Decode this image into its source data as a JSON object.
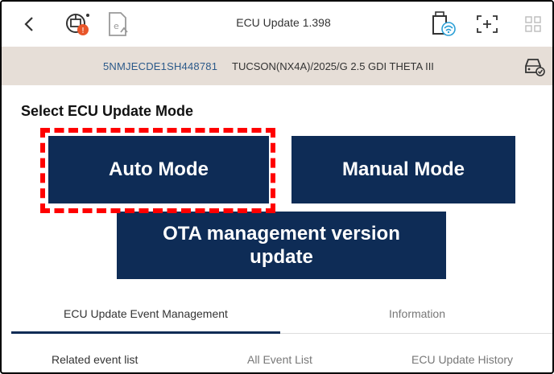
{
  "header": {
    "title": "ECU Update 1.398",
    "icons": [
      "back-chevron",
      "engine-warning",
      "ecu-document-upload",
      "vci-wireless",
      "screen-capture",
      "grid-menu"
    ]
  },
  "vehicle": {
    "vin": "5NMJECDE1SH448781",
    "model": "TUCSON(NX4A)/2025/G 2.5 GDI THETA III"
  },
  "main": {
    "heading": "Select ECU Update Mode",
    "buttons": {
      "auto": "Auto Mode",
      "manual": "Manual Mode",
      "ota": "OTA management version update"
    }
  },
  "tabs": [
    {
      "label": "ECU Update Event Management",
      "active": true
    },
    {
      "label": "Information",
      "active": false
    }
  ],
  "subtabs": [
    {
      "label": "Related event list",
      "active": true
    },
    {
      "label": "All Event List",
      "active": false
    },
    {
      "label": "ECU Update History",
      "active": false
    }
  ],
  "colors": {
    "button": "#0e2c56",
    "vehicle_bar": "#e6ded7",
    "vin_text": "#2c5a8a",
    "highlight": "#ff0000",
    "warning": "#e8562a"
  }
}
